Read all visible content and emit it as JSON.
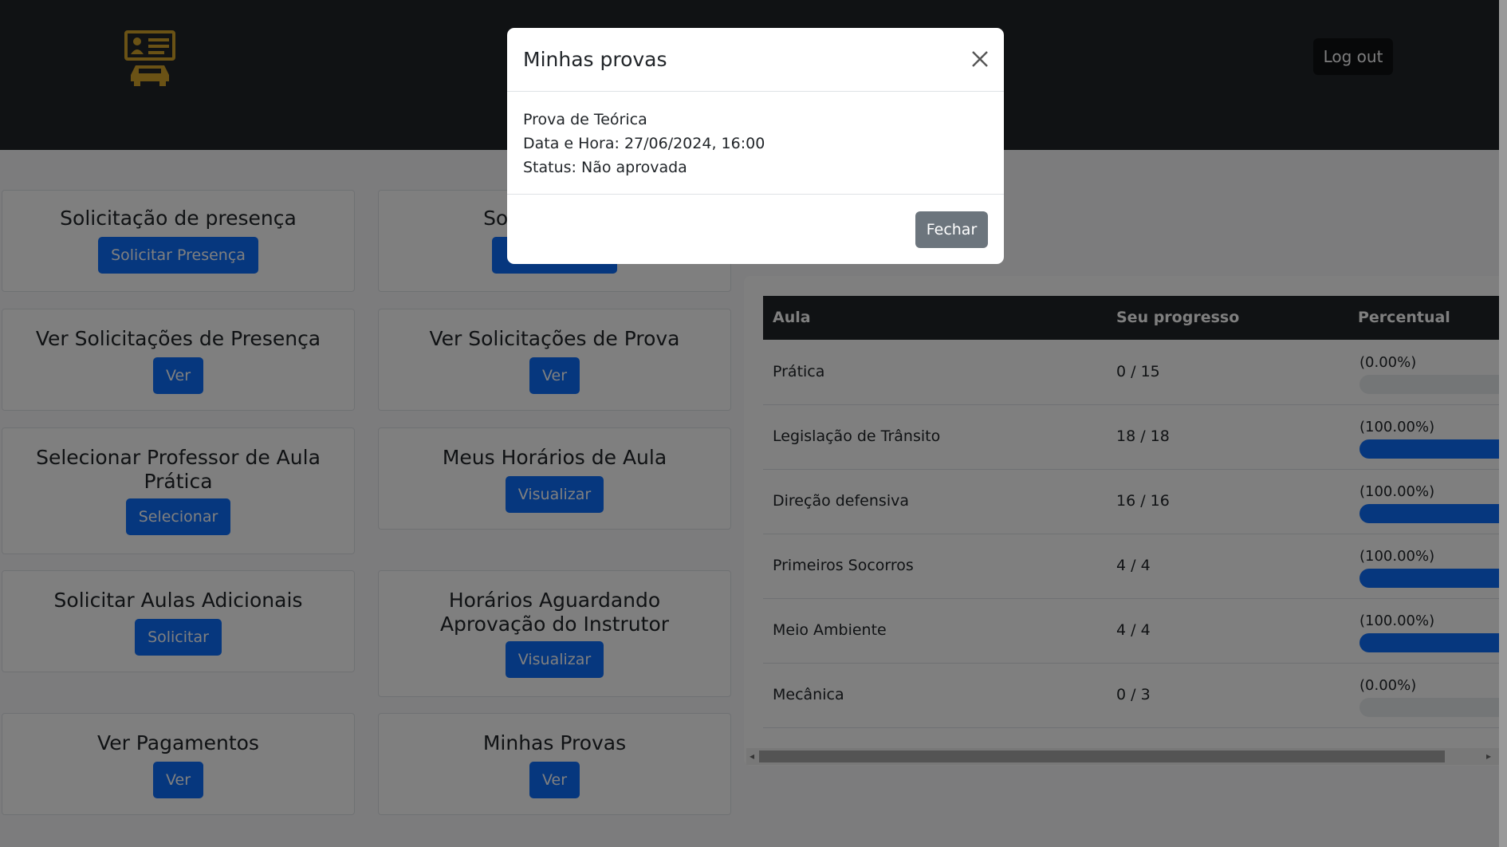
{
  "header": {
    "logout_label": "Log out"
  },
  "cards": [
    {
      "title": "Solicitação de presença",
      "button": "Solicitar Presença"
    },
    {
      "title": "Solicitar Prova",
      "button": "Solicitar"
    },
    {
      "title": "Ver Solicitações de Presença",
      "button": "Ver"
    },
    {
      "title": "Ver Solicitações de Prova",
      "button": "Ver"
    },
    {
      "title": "Selecionar Professor de Aula Prática",
      "button": "Selecionar"
    },
    {
      "title": "Meus Horários de Aula",
      "button": "Visualizar"
    },
    {
      "title": "Solicitar Aulas Adicionais",
      "button": "Solicitar"
    },
    {
      "title": "Horários Aguardando Aprovação do Instrutor",
      "button": "Visualizar"
    },
    {
      "title": "Ver Pagamentos",
      "button": "Ver"
    },
    {
      "title": "Minhas Provas",
      "button": "Ver"
    }
  ],
  "progress_table": {
    "headers": [
      "Aula",
      "Seu progresso",
      "Percentual"
    ],
    "rows": [
      {
        "aula": "Prática",
        "progresso": "0 / 15",
        "percentual": "(0.00%)",
        "fill": 0
      },
      {
        "aula": "Legislação de Trânsito",
        "progresso": "18 / 18",
        "percentual": "(100.00%)",
        "fill": 100
      },
      {
        "aula": "Direção defensiva",
        "progresso": "16 / 16",
        "percentual": "(100.00%)",
        "fill": 100
      },
      {
        "aula": "Primeiros Socorros",
        "progresso": "4 / 4",
        "percentual": "(100.00%)",
        "fill": 100
      },
      {
        "aula": "Meio Ambiente",
        "progresso": "4 / 4",
        "percentual": "(100.00%)",
        "fill": 100
      },
      {
        "aula": "Mecânica",
        "progresso": "0 / 3",
        "percentual": "(0.00%)",
        "fill": 0
      }
    ]
  },
  "modal": {
    "title": "Minhas provas",
    "exam_name": "Prova de Teórica",
    "date_line": "Data e Hora: 27/06/2024, 16:00",
    "status_line": "Status: Não aprovada",
    "close_label": "Fechar"
  },
  "colors": {
    "navbar": "#212529",
    "primary": "#0d6efd",
    "secondary": "#6c757d",
    "logo": "#d4a52a"
  },
  "icons": {
    "logo": "driver-license-car-icon",
    "close": "close-icon"
  }
}
